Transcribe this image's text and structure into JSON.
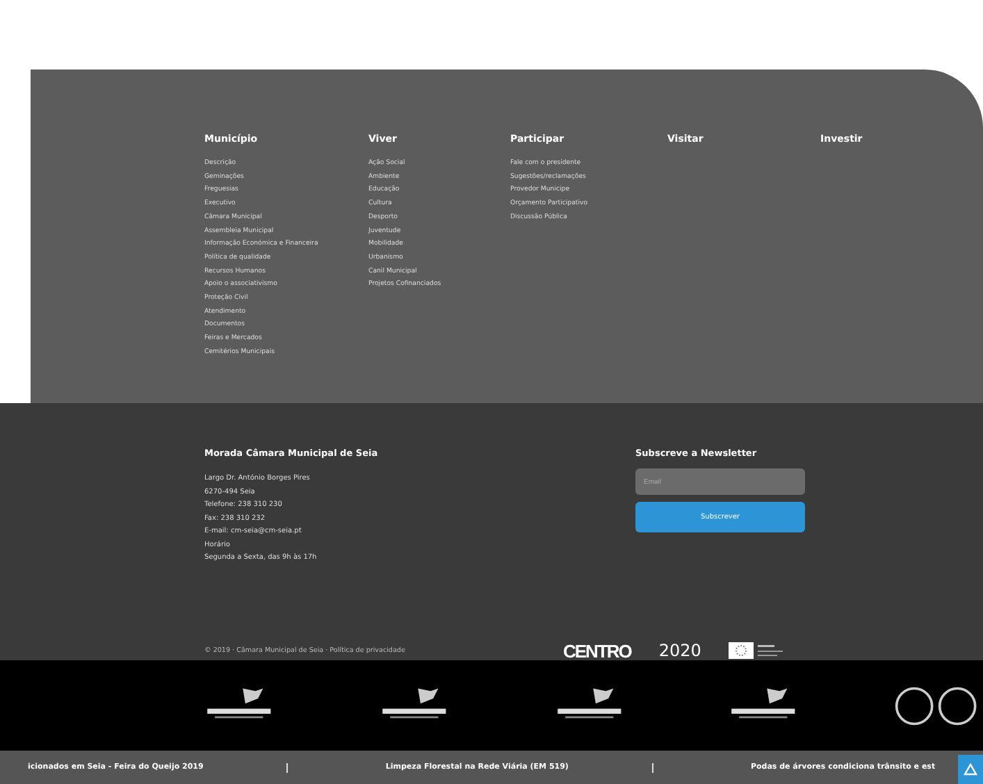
{
  "menu_columns": [
    {
      "heading": "Município",
      "items": [
        "Descrição",
        "Geminações",
        "Freguesias",
        "Executivo",
        "Câmara Municipal",
        "Assembleia Municipal",
        "Informação Económica e Financeira",
        "Política de qualidade",
        "Recursos Humanos",
        "Apoio o associativismo",
        "Proteção Civil",
        "Atendimento",
        "Documentos",
        "Feiras e Mercados",
        "Cemitérios Municipais"
      ]
    },
    {
      "heading": "Viver",
      "items": [
        "Ação Social",
        "Ambiente",
        "Educação",
        "Cultura",
        "Desporto",
        "Juventude",
        "Mobilidade",
        "Urbanismo",
        "Canil Municipal",
        "Projetos Cofinanciados"
      ]
    },
    {
      "heading": "Participar",
      "items": [
        "Fale com o presidente",
        "Sugestões/reclamações",
        "Provedor Municipe",
        "Orçamento Participativo",
        "Discussão Pública"
      ]
    },
    {
      "heading": "Visitar"
    },
    {
      "heading": "Investir"
    }
  ],
  "address": {
    "heading": "Morada Câmara Municipal de Seia",
    "lines": [
      "Largo Dr. António Borges Pires",
      "6270-494 Seia",
      "Telefone: 238 310 230",
      "Fax: 238 310 232",
      "E-mail: cm-seia@cm-seia.pt",
      "Horário",
      "Segunda a Sexta, das 9h às 17h"
    ]
  },
  "newsletter": {
    "heading": "Subscreve a Newsletter",
    "placeholder": "Email",
    "button": "Subscrever"
  },
  "copyright": "© 2019 · Câmara Municipal de Seia · Política de privacidade",
  "funding_logos": [
    {
      "kind": "centro",
      "text": "CENTRO"
    },
    {
      "kind": "portugal2020",
      "text": "2020"
    },
    {
      "kind": "eu"
    }
  ],
  "partner_logos": [
    {
      "kind": "emblem"
    },
    {
      "kind": "emblem"
    },
    {
      "kind": "emblem"
    },
    {
      "kind": "emblem"
    },
    {
      "kind": "rings"
    }
  ],
  "ticker": [
    "icionados em Seia - Feira do Queijo 2019",
    "Limpeza Florestal na Rede Viária (EM 519)",
    "Podas de árvores condiciona trânsito e est"
  ]
}
